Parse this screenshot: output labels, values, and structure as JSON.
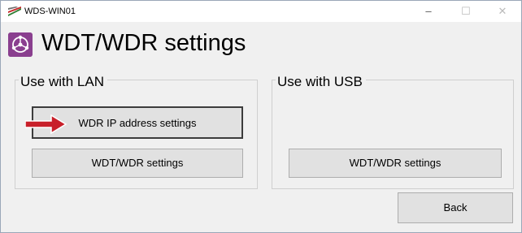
{
  "window": {
    "title": "WDS-WIN01",
    "minimize_glyph": "–",
    "maximize_glyph": "☐",
    "close_glyph": "✕"
  },
  "header": {
    "title": "WDT/WDR settings",
    "icon": "network-settings-icon"
  },
  "lan_group": {
    "label": "Use with LAN",
    "ip_button": "WDR IP address settings",
    "wdt_button": "WDT/WDR settings"
  },
  "usb_group": {
    "label": "Use with USB",
    "wdt_button": "WDT/WDR settings"
  },
  "footer": {
    "back_button": "Back"
  },
  "colors": {
    "accent_icon": "#8a3f8f",
    "arrow": "#c8202a"
  }
}
